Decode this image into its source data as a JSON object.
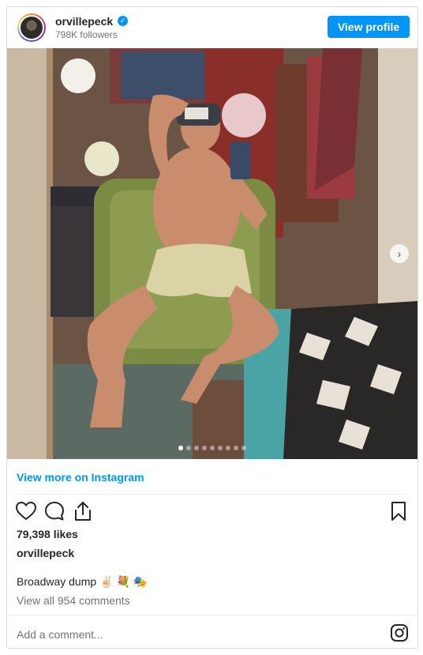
{
  "header": {
    "username": "orvillepeck",
    "followers": "798K followers",
    "view_profile_label": "View profile"
  },
  "post": {
    "image_alt": "Mirror selfie in a dressing room",
    "carousel_dots": 9,
    "active_dot": 1
  },
  "footer": {
    "view_more_label": "View more on Instagram",
    "likes": "79,398 likes",
    "owner": "orvillepeck",
    "caption_text": "Broadway dump",
    "caption_emoji": "✌🏻 💐 🎭",
    "comments_link": "View all 954 comments",
    "add_comment_placeholder": "Add a comment..."
  },
  "icons": {
    "verified": "verified-badge-icon",
    "like": "heart-icon",
    "comment": "comment-icon",
    "share": "share-icon",
    "save": "bookmark-icon",
    "instagram": "instagram-icon",
    "next": "chevron-right-icon"
  },
  "colors": {
    "accent": "#0095f6",
    "text": "#262626",
    "muted": "#737373",
    "border": "#dbdbdb"
  }
}
